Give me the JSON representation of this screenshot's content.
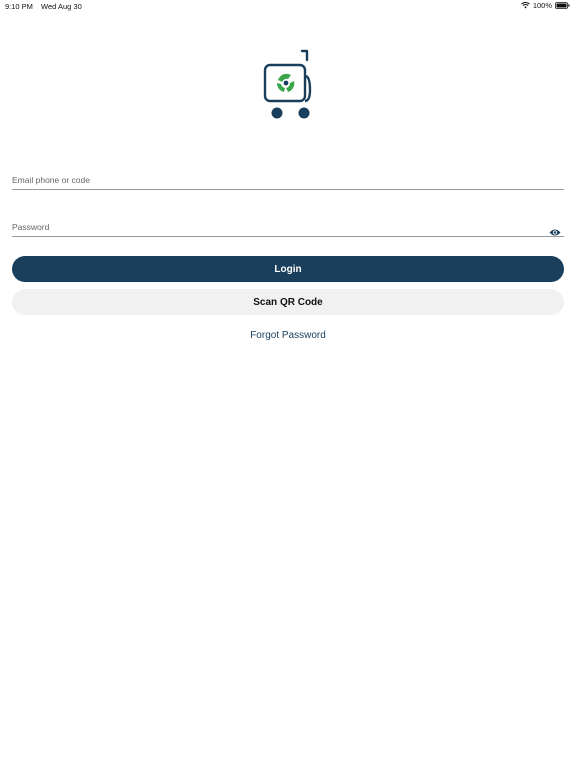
{
  "status_bar": {
    "time": "9:10 PM",
    "date": "Wed Aug 30",
    "battery": "100%",
    "icons": [
      "wifi-icon",
      "battery-icon"
    ]
  },
  "logo": {
    "icon": "cart-logo-icon",
    "colors": {
      "cart": "#1a3f5c",
      "swirl": "#3aa64a"
    }
  },
  "form": {
    "email_placeholder": "Email phone or code",
    "email_value": "",
    "password_placeholder": "Password",
    "password_value": "",
    "password_toggle_icon": "eye-icon"
  },
  "actions": {
    "login_label": "Login",
    "scan_label": "Scan QR Code",
    "forgot_label": "Forgot Password"
  },
  "colors": {
    "primary": "#1a3f5c",
    "secondary_button": "#f1f1f1",
    "background": "#ffffff"
  }
}
